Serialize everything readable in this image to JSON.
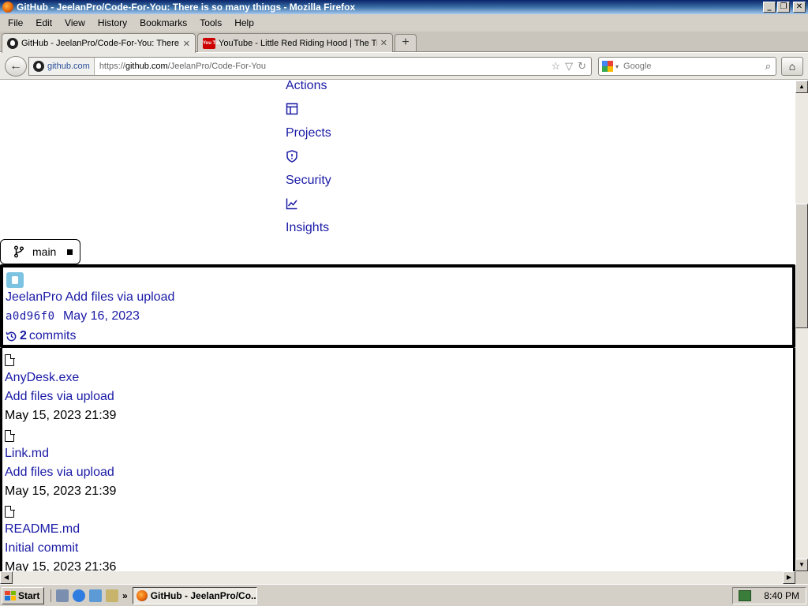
{
  "window": {
    "title": "GitHub - JeelanPro/Code-For-You: There is so many things - Mozilla Firefox",
    "minimize": "_",
    "restore": "❐",
    "close": "✕"
  },
  "menu": {
    "file": "File",
    "edit": "Edit",
    "view": "View",
    "history": "History",
    "bookmarks": "Bookmarks",
    "tools": "Tools",
    "help": "Help"
  },
  "tabs": [
    {
      "label": "GitHub - JeelanPro/Code-For-You: There ...",
      "close": "✕"
    },
    {
      "label": "YouTube - Little Red Riding Hood | The Tr...",
      "close": "✕",
      "favicon_text": "You Tube"
    }
  ],
  "new_tab": "+",
  "toolbar": {
    "back": "←",
    "identity_domain": "github.com",
    "url_prefix": "https://",
    "url_domain": "github.com",
    "url_path": "/JeelanPro/Code-For-You",
    "star": "☆",
    "dropdown": "▽",
    "reload": "↻",
    "search_placeholder": "Google",
    "search_glyph": "⌕",
    "home": "⌂"
  },
  "repo_nav": {
    "actions": "Actions",
    "projects": "Projects",
    "security": "Security",
    "insights": "Insights"
  },
  "branch": {
    "label": "main"
  },
  "latest_commit": {
    "author": "JeelanPro",
    "message": "Add files via upload",
    "sha": "a0d96f0",
    "date": "May 16, 2023",
    "count": "2",
    "commits_label": "commits"
  },
  "files": [
    {
      "name": "AnyDesk.exe",
      "message": "Add files via upload",
      "date": "May 15, 2023 21:39"
    },
    {
      "name": "Link.md",
      "message": "Add files via upload",
      "date": "May 15, 2023 21:39"
    },
    {
      "name": "README.md",
      "message": "Initial commit",
      "date": "May 15, 2023 21:36"
    }
  ],
  "scrollbar": {
    "up": "▲",
    "down": "▼",
    "left": "◀",
    "right": "▶"
  },
  "taskbar": {
    "start": "Start",
    "overflow": "»",
    "task_label": "GitHub - JeelanPro/Co...",
    "clock": "8:40 PM"
  },
  "colors": {
    "link": "#1a1aa6",
    "titlebar": "#0a246a",
    "chrome": "#d4d0c8"
  }
}
